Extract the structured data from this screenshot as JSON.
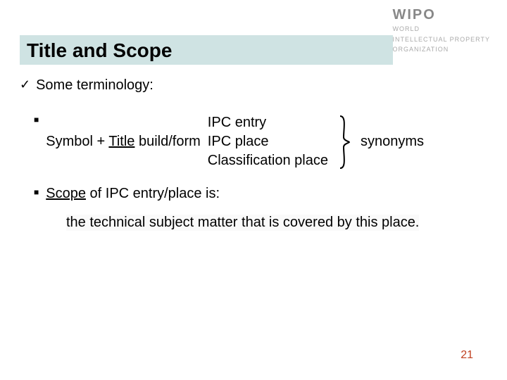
{
  "logo": {
    "main": "WIPO",
    "line1": "WORLD",
    "line2": "INTELLECTUAL PROPERTY",
    "line3": "ORGANIZATION"
  },
  "title": "Title and Scope",
  "terminology_label": "Some terminology:",
  "bullet1": {
    "prefix": "Symbol + ",
    "title_word": "Title",
    "mid": " build/form ",
    "items": [
      "IPC entry",
      "IPC place",
      "Classification place"
    ],
    "syn": "synonyms"
  },
  "bullet2": {
    "scope_word": "Scope",
    "mid": " of IPC entry/place is:",
    "definition": "the technical subject matter that is covered by this place."
  },
  "page_number": "21"
}
